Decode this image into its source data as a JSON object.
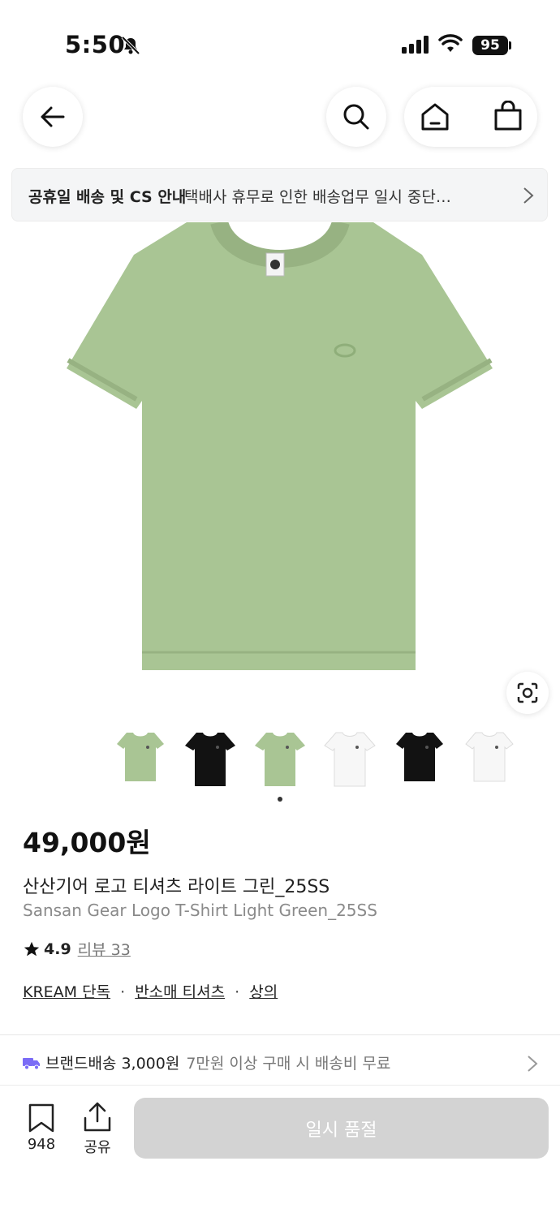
{
  "status_bar": {
    "time": "5:50",
    "battery": "95"
  },
  "notice": {
    "strong": "공휴일 배송 및 CS 안내",
    "text": "택배사 휴무로 인한 배송업무 일시 중단…"
  },
  "thumbnails": [
    {
      "color": "#a9c594",
      "style": "crop"
    },
    {
      "color": "#121212",
      "style": "tee"
    },
    {
      "color": "#a9c594",
      "style": "tee"
    },
    {
      "color": "#f7f7f7",
      "style": "tee"
    },
    {
      "color": "#121212",
      "style": "crop"
    },
    {
      "color": "#f7f7f7",
      "style": "crop"
    }
  ],
  "product": {
    "price": "49,000원",
    "name_ko": "산산기어 로고 티셔츠 라이트 그린_25SS",
    "name_en": "Sansan Gear Logo T-Shirt Light Green_25SS",
    "rating": "4.9",
    "reviews": "리뷰 33",
    "tags": [
      "KREAM 단독",
      "반소매 티셔츠",
      "상의"
    ]
  },
  "shipping": {
    "label": "브랜드배송 3,000원",
    "desc": "7만원 이상 구매 시 배송비 무료",
    "accent": "#7b6cf6"
  },
  "bottom_bar": {
    "save_count": "948",
    "share_label": "공유",
    "buy_label": "일시 품절"
  }
}
